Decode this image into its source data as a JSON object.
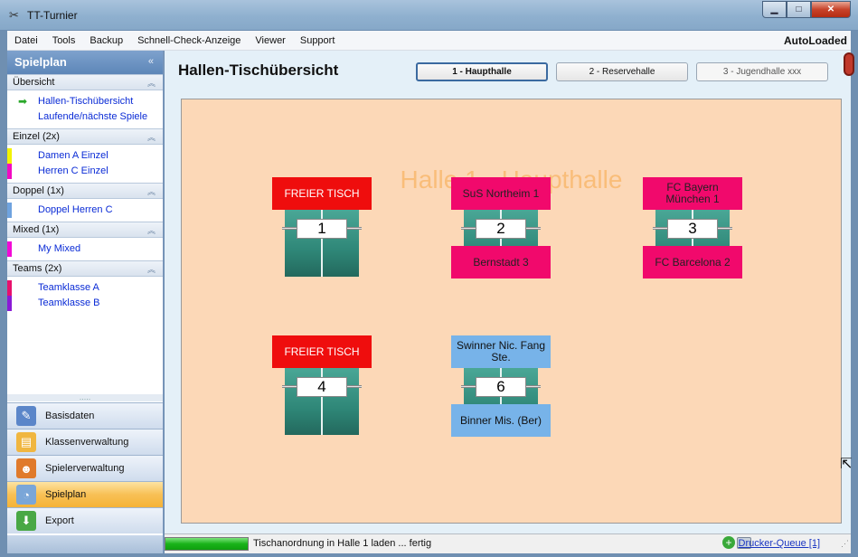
{
  "window": {
    "title": "TT-Turnier",
    "icon": "tt-app-icon"
  },
  "menu": {
    "items": [
      "Datei",
      "Tools",
      "Backup",
      "Schnell-Check-Anzeige",
      "Viewer",
      "Support"
    ],
    "status_right": "AutoLoaded"
  },
  "sidebar": {
    "header": "Spielplan",
    "groups": [
      {
        "title": "Übersicht",
        "items": [
          {
            "label": "Hallen-Tischübersicht",
            "marker": "",
            "selected": true
          },
          {
            "label": "Laufende/nächste Spiele",
            "marker": "",
            "selected": false
          }
        ]
      },
      {
        "title": "Einzel (2x)",
        "items": [
          {
            "label": "Damen A Einzel",
            "marker": "#f2f200"
          },
          {
            "label": "Herren C Einzel",
            "marker": "#f20ac2"
          }
        ]
      },
      {
        "title": "Doppel (1x)",
        "items": [
          {
            "label": "Doppel Herren C",
            "marker": "#6fa3df"
          }
        ]
      },
      {
        "title": "Mixed (1x)",
        "items": [
          {
            "label": "My Mixed",
            "marker": "#f20ad6"
          }
        ]
      },
      {
        "title": "Teams (2x)",
        "items": [
          {
            "label": "Teamklasse A",
            "marker": "#e8106c"
          },
          {
            "label": "Teamklasse B",
            "marker": "#8a1ad6"
          }
        ]
      }
    ],
    "nav_buttons": [
      {
        "label": "Basisdaten",
        "icon": "clipboard-icon",
        "active": false
      },
      {
        "label": "Klassenverwaltung",
        "icon": "folder-icon",
        "active": false
      },
      {
        "label": "Spielerverwaltung",
        "icon": "users-icon",
        "active": false
      },
      {
        "label": "Spielplan",
        "icon": "calendar-clock-icon",
        "active": true
      },
      {
        "label": "Export",
        "icon": "export-arrow-icon",
        "active": false
      }
    ]
  },
  "main": {
    "title": "Hallen-Tischübersicht",
    "hall_tabs": [
      {
        "label": "1 - Haupthalle",
        "state": "active"
      },
      {
        "label": "2 - Reservehalle",
        "state": "normal"
      },
      {
        "label": "3 - Jugendhalle xxx",
        "state": "inactive"
      }
    ],
    "hall_name": "Halle 1 - Haupthalle",
    "tables": [
      {
        "number": "1",
        "top": "FREIER TISCH",
        "bottom": "",
        "color": "red"
      },
      {
        "number": "2",
        "top": "SuS Northeim 1",
        "bottom": "Bernstadt 3",
        "color": "pink"
      },
      {
        "number": "3",
        "top": "FC Bayern München 1",
        "bottom": "FC Barcelona 2",
        "color": "pink"
      },
      {
        "number": "4",
        "top": "FREIER TISCH",
        "bottom": "",
        "color": "red"
      },
      {
        "number": "6",
        "top": "Swinner Nic. Fang Ste.",
        "bottom": "Binner Mis. (Ber)",
        "color": "blue"
      }
    ]
  },
  "status": {
    "progress": 1.0,
    "text": "Tischanordnung in Halle 1 laden ... fertig",
    "queue_label": "Drucker-Queue [1]"
  },
  "colors": {
    "hall_bg": "#fcd8b7",
    "hall_name": "#f9bd79",
    "free": "#ef0d0d",
    "match_team": "#f1096c",
    "match_doubles": "#77b3e9"
  }
}
